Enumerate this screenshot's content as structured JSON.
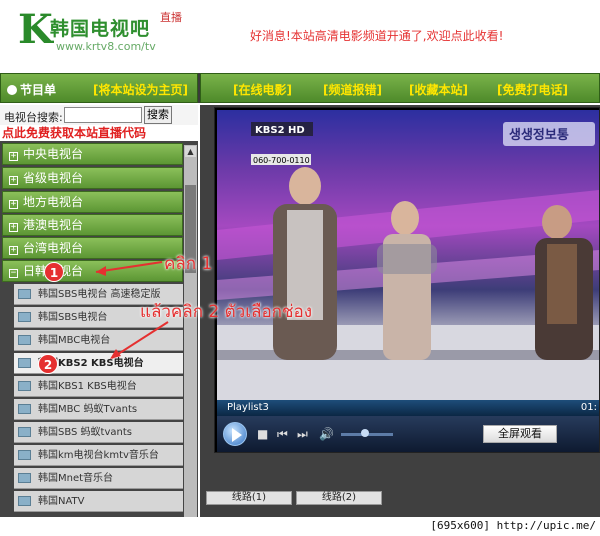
{
  "header": {
    "logo_letter": "K",
    "logo_name": "韩国电视吧",
    "logo_live": "直播",
    "logo_url": "www.krtv8.com/tv",
    "notice": "好消息!本站高清电影频道开通了,欢迎点此收看!"
  },
  "nav": {
    "menu_label": "节目单",
    "set_home": "[将本站设为主页]",
    "links": [
      "[在线电影]",
      "[频道报错]",
      "[收藏本站]",
      "[免费打电话]"
    ]
  },
  "sidebar": {
    "search_label": "电视台搜索:",
    "search_value": "",
    "search_button": "搜索",
    "promo": "点此免费获取本站直播代码",
    "categories": [
      "中央电视台",
      "省级电视台",
      "地方电视台",
      "港澳电视台",
      "台湾电视台",
      "日韩电视台"
    ],
    "expanded_category": "日韩电视台",
    "channels": [
      "韩国SBS电视台  高速稳定版",
      "韩国SBS电视台",
      "韩国MBC电视台",
      "韩国KBS2 KBS电视台",
      "韩国KBS1 KBS电视台",
      "韩国MBC 蚂蚁Tvants",
      "韩国SBS 蚂蚁tvants",
      "韩国km电视台kmtv音乐台",
      "韩国Mnet音乐台",
      "韩国NATV"
    ],
    "active_channel": "韩国KBS2 KBS电视台"
  },
  "player": {
    "playlist_label": "Playlist3",
    "time": "01:",
    "fullscreen_label": "全屏观看",
    "video_description": "KBS2 studio broadcast",
    "video_overlay": {
      "station_logo": "KBS2 HD",
      "phone": "060-700-0110",
      "show_tag": "생생정보통"
    }
  },
  "routes": [
    "线路(1)",
    "线路(2)"
  ],
  "annotations": {
    "step1": "คลิก 1",
    "step2": "แล้วคลิก 2 ตัวเลือกช่อง",
    "badge1": "1",
    "badge2": "2"
  },
  "footer": {
    "text": "[695x600] http://upic.me/"
  },
  "colors": {
    "nav_green": "#5c9634",
    "accent_red": "#e53030",
    "link_yellow": "#ffe600"
  }
}
